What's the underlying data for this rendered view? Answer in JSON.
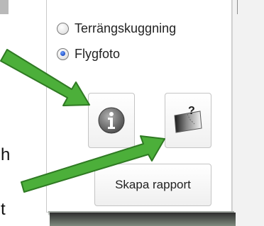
{
  "panel": {
    "radio_options": [
      {
        "label": "Terrängskuggning",
        "checked": false
      },
      {
        "label": "Flygfoto",
        "checked": true
      }
    ],
    "info_button_icon": "info-icon",
    "map_query_button_icon": "map-question-icon",
    "report_button_label": "Skapa rapport"
  },
  "edge_text": {
    "glyph_1": "h",
    "glyph_2": "t"
  },
  "colors": {
    "arrow_fill": "#4caf3a",
    "arrow_stroke": "#2f7a23",
    "radio_checked": "#1f4fc4"
  }
}
